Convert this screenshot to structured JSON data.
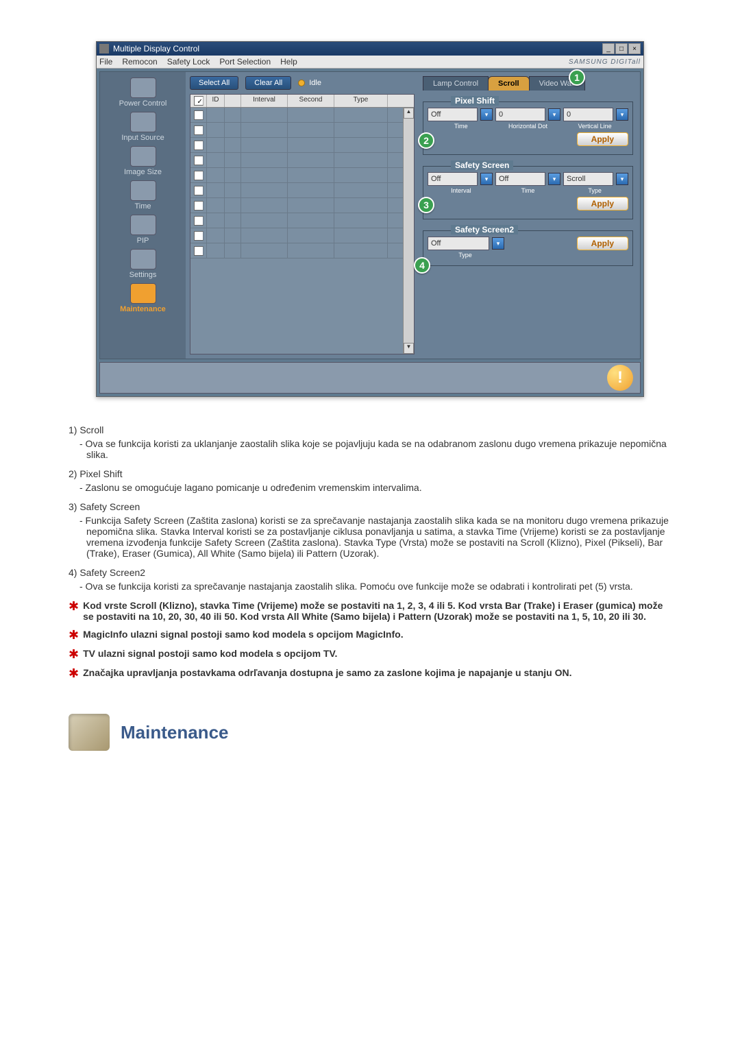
{
  "window": {
    "title": "Multiple Display Control",
    "minimize": "_",
    "maximize": "□",
    "close": "×",
    "brand": "SAMSUNG DIGITall"
  },
  "menu": {
    "file": "File",
    "remocon": "Remocon",
    "safety_lock": "Safety Lock",
    "port_selection": "Port Selection",
    "help": "Help"
  },
  "sidebar": {
    "items": [
      {
        "label": "Power Control"
      },
      {
        "label": "Input Source"
      },
      {
        "label": "Image Size"
      },
      {
        "label": "Time"
      },
      {
        "label": "PIP"
      },
      {
        "label": "Settings"
      },
      {
        "label": "Maintenance"
      }
    ]
  },
  "buttons": {
    "select_all": "Select All",
    "clear_all": "Clear All",
    "idle": "Idle",
    "apply": "Apply"
  },
  "grid": {
    "id": "ID",
    "interval": "Interval",
    "second": "Second",
    "type": "Type"
  },
  "tabs": {
    "lamp": "Lamp Control",
    "scroll": "Scroll",
    "video_wall": "Video Wall"
  },
  "pixel_shift": {
    "title": "Pixel Shift",
    "off": "Off",
    "value2": "0",
    "value3": "0",
    "time": "Time",
    "horiz": "Horizontal Dot",
    "vert": "Vertical Line"
  },
  "safety_screen": {
    "title": "Safety Screen",
    "off": "Off",
    "off2": "Off",
    "scroll": "Scroll",
    "interval": "Interval",
    "time": "Time",
    "type": "Type"
  },
  "safety_screen2": {
    "title": "Safety Screen2",
    "off": "Off",
    "type": "Type"
  },
  "markers": {
    "m1": "1",
    "m2": "2",
    "m3": "3",
    "m4": "4"
  },
  "doc": {
    "i1_head": "1)  Scroll",
    "i1_desc": "- Ova se funkcija koristi za uklanjanje zaostalih slika koje se pojavljuju kada se na odabranom zaslonu dugo vremena prikazuje nepomična slika.",
    "i2_head": "2)  Pixel Shift",
    "i2_desc": "- Zaslonu se omogućuje lagano pomicanje u određenim vremenskim intervalima.",
    "i3_head": "3)  Safety Screen",
    "i3_desc": "- Funkcija Safety Screen (Zaštita zaslona) koristi se za sprečavanje nastajanja zaostalih slika kada se na monitoru dugo vremena prikazuje nepomična slika.  Stavka Interval koristi se za postavljanje ciklusa ponavljanja u satima, a stavka Time (Vrijeme) koristi se za postavljanje vremena izvođenja funkcije Safety Screen (Zaštita zaslona). Stavka Type (Vrsta) može se postaviti na Scroll (Klizno), Pixel (Pikseli), Bar (Trake), Eraser (Gumica), All White (Samo bijela) ili Pattern (Uzorak).",
    "i4_head": "4)  Safety Screen2",
    "i4_desc": "- Ova se funkcija koristi za sprečavanje nastajanja zaostalih slika. Pomoću ove funkcije može se odabrati i kontrolirati pet (5) vrsta.",
    "star1": "Kod vrste Scroll (Klizno), stavka Time (Vrijeme) može se postaviti na 1, 2, 3, 4 ili 5. Kod vrsta Bar (Trake) i Eraser (gumica) može se postaviti na 10, 20, 30, 40 ili 50. Kod vrsta All White (Samo bijela) i Pattern (Uzorak) može se postaviti na 1, 5, 10, 20 ili 30.",
    "star2": "MagicInfo ulazni signal postoji samo kod modela s opcijom MagicInfo.",
    "star3": "TV ulazni signal postoji samo kod modela s opcijom TV.",
    "star4": "Značajka upravljanja postavkama odrľavanja dostupna je samo za zaslone kojima je napajanje u stanju ON.",
    "maint_title": "Maintenance"
  }
}
